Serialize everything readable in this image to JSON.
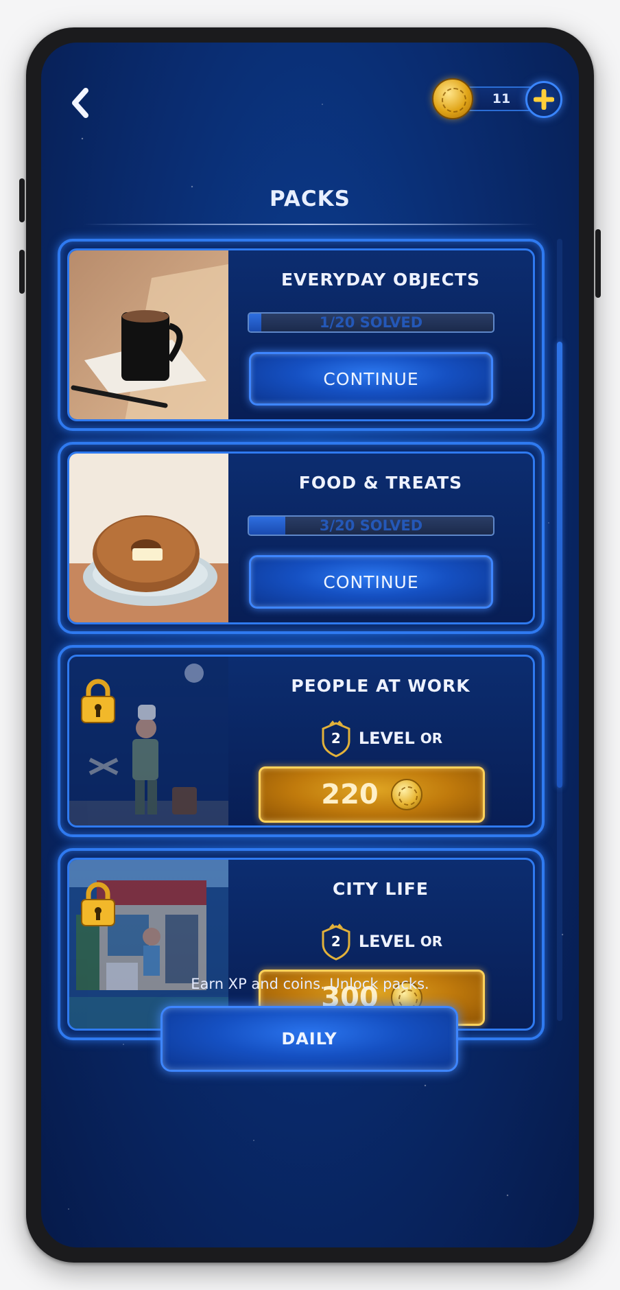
{
  "header": {
    "back_icon": "chevron-left-icon",
    "coins": "11",
    "add_coins_icon": "plus-icon",
    "title": "PACKS"
  },
  "packs": [
    {
      "name": "EVERYDAY OBJECTS",
      "image": "coffee-mug-image",
      "locked": false,
      "solved": 1,
      "total": 20,
      "progress_text": "1/20 SOLVED",
      "button_label": "CONTINUE"
    },
    {
      "name": "FOOD & TREATS",
      "image": "donut-image",
      "locked": false,
      "solved": 3,
      "total": 20,
      "progress_text": "3/20 SOLVED",
      "button_label": "CONTINUE"
    },
    {
      "name": "PEOPLE AT WORK",
      "image": "chef-worker-image",
      "locked": true,
      "level": "2",
      "level_label": "LEVEL",
      "or_label": "OR",
      "price": "220"
    },
    {
      "name": "CITY LIFE",
      "image": "city-street-image",
      "locked": true,
      "level": "2",
      "level_label": "LEVEL",
      "or_label": "OR",
      "price": "300"
    }
  ],
  "footer": {
    "text": "Earn XP and coins. Unlock packs.",
    "daily_label": "DAILY"
  },
  "colors": {
    "background": "#0a2d72",
    "accent_blue": "#2f7af0",
    "gold": "#e0a623",
    "text": "#eef2ff"
  }
}
